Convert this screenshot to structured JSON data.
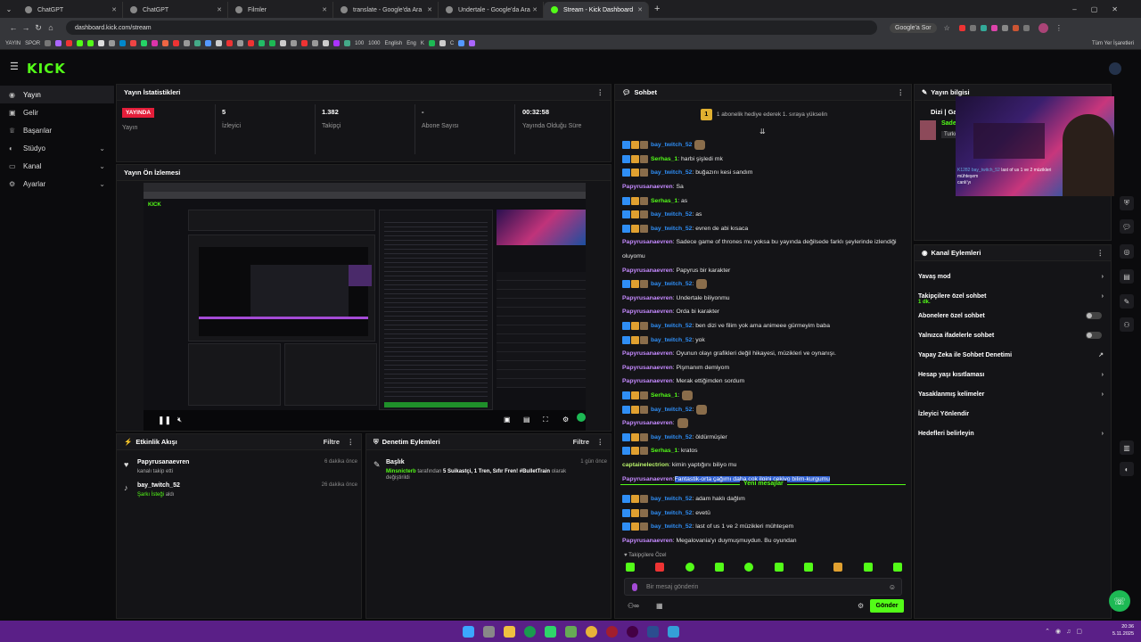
{
  "browser": {
    "tabs": [
      {
        "label": "ChatGPT",
        "active": false
      },
      {
        "label": "ChatGPT",
        "active": false
      },
      {
        "label": "Filmler",
        "active": false
      },
      {
        "label": "translate - Google'da Ara",
        "active": false
      },
      {
        "label": "Undertale - Google'da Ara",
        "active": false
      },
      {
        "label": "Stream - Kick Dashboard",
        "active": true
      }
    ],
    "url": "dashboard.kick.com/stream",
    "search_engine": "Google'a Sor",
    "bookmarks": [
      "YAYIN",
      "SPOR",
      "100",
      "1000",
      "English",
      "Eng",
      "K",
      "C"
    ],
    "all_bookmarks": "Tüm Yer İşaretleri"
  },
  "brand": {
    "logo": "KICK",
    "accent": "#53fc18"
  },
  "sidebar": {
    "items": [
      {
        "label": "Yayın",
        "icon": "broadcast-icon",
        "chev": false
      },
      {
        "label": "Gelir",
        "icon": "wallet-icon",
        "chev": false
      },
      {
        "label": "Başarılar",
        "icon": "trophy-icon",
        "chev": false
      },
      {
        "label": "Stüdyo",
        "icon": "palette-icon",
        "chev": true
      },
      {
        "label": "Kanal",
        "icon": "channel-icon",
        "chev": true
      },
      {
        "label": "Ayarlar",
        "icon": "gear-icon",
        "chev": true
      }
    ]
  },
  "stats": {
    "title": "Yayın İstatistikleri",
    "live_badge": "YAYINDA",
    "items": [
      {
        "value": "",
        "label": "Yayın"
      },
      {
        "value": "5",
        "label": "İzleyici"
      },
      {
        "value": "1.382",
        "label": "Takipçi"
      },
      {
        "value": "-",
        "label": "Abone Sayısı"
      },
      {
        "value": "00:32:58",
        "label": "Yayında Olduğu Süre"
      }
    ]
  },
  "preview": {
    "title": "Yayın Ön İzlemesi"
  },
  "activity": {
    "title": "Etkinlik Akışı",
    "filter": "Filtre",
    "items": [
      {
        "user": "Papyrusanaevren",
        "action": "kanalı takip etti",
        "time": "6 dakika önce"
      },
      {
        "user": "bay_twitch_52",
        "action": "Şarkı İsteği",
        "action2": "aldı",
        "time": "26 dakika önce"
      }
    ]
  },
  "moderation": {
    "title": "Denetim Eylemleri",
    "filter": "Filtre",
    "items": [
      {
        "title": "Başlık",
        "user": "Minsnicterb",
        "text": "tarafından",
        "stream_title": "5 Suikastçi, 1 Tren, Sıfır Fren! #BulletTrain",
        "suffix": "olarak",
        "line2": "değiştirildi",
        "time": "1 gün önce"
      }
    ]
  },
  "chat": {
    "title": "Sohbet",
    "pinned": "1 abonelik hediye ederek 1. sıraya yükselin",
    "new_messages": "Yeni mesajlar",
    "followers_only": "Takipçilere Özel",
    "input_placeholder": "Bir mesaj gönderin",
    "send": "Gönder",
    "messages": [
      {
        "user": "bay_twitch_52",
        "color": "#2f8ef5",
        "badges": 3,
        "text": "",
        "emote": true
      },
      {
        "user": "Serhas_1",
        "color": "#53fc18",
        "badges": 3,
        "text": ": harbi şişledi mk"
      },
      {
        "user": "bay_twitch_52",
        "color": "#2f8ef5",
        "badges": 3,
        "text": ": buğazını kesi sandım"
      },
      {
        "user": "Papyrusanaevren",
        "color": "#c58aff",
        "badges": 0,
        "text": ": Sa"
      },
      {
        "user": "Serhas_1",
        "color": "#53fc18",
        "badges": 3,
        "text": ": as"
      },
      {
        "user": "bay_twitch_52",
        "color": "#2f8ef5",
        "badges": 3,
        "text": ": as"
      },
      {
        "user": "bay_twitch_52",
        "color": "#2f8ef5",
        "badges": 3,
        "text": ": evren de abi kısaca"
      },
      {
        "user": "Papyrusanaevren",
        "color": "#c58aff",
        "badges": 0,
        "text": ": Sadece game of thrones mu yoksa bu yayında değilsede farklı şeylerinde izlendiği"
      },
      {
        "user": "",
        "color": "#e6e6e6",
        "badges": 0,
        "text": "oluyomu"
      },
      {
        "user": "Papyrusanaevren",
        "color": "#c58aff",
        "badges": 0,
        "text": ": Papyrus bir karakter"
      },
      {
        "user": "bay_twitch_52",
        "color": "#2f8ef5",
        "badges": 3,
        "text": ":",
        "emote": true
      },
      {
        "user": "Papyrusanaevren",
        "color": "#c58aff",
        "badges": 0,
        "text": ": Undertale biliyonmu"
      },
      {
        "user": "Papyrusanaevren",
        "color": "#c58aff",
        "badges": 0,
        "text": ": Orda bi karakter"
      },
      {
        "user": "bay_twitch_52",
        "color": "#2f8ef5",
        "badges": 3,
        "text": ": ben dizi ve filim yok ama animeee gürmeyim baba"
      },
      {
        "user": "bay_twitch_52",
        "color": "#2f8ef5",
        "badges": 3,
        "text": ": yok"
      },
      {
        "user": "Papyrusanaevren",
        "color": "#c58aff",
        "badges": 0,
        "text": ": Oyunun olayı grafikleri değil hikayesi, müzikleri ve oynanışı."
      },
      {
        "user": "Papyrusanaevren",
        "color": "#c58aff",
        "badges": 0,
        "text": ": Pişmanım demiyom"
      },
      {
        "user": "Papyrusanaevren",
        "color": "#c58aff",
        "badges": 0,
        "text": ": Merak ettiğimden sordum"
      },
      {
        "user": "Serhas_1",
        "color": "#53fc18",
        "badges": 3,
        "text": ":",
        "emote": true
      },
      {
        "user": "bay_twitch_52",
        "color": "#2f8ef5",
        "badges": 3,
        "text": ":",
        "emote": true
      },
      {
        "user": "Papyrusanaevren",
        "color": "#c58aff",
        "badges": 0,
        "text": ":",
        "emote": true
      },
      {
        "user": "bay_twitch_52",
        "color": "#2f8ef5",
        "badges": 3,
        "text": ": öldürmüşler"
      },
      {
        "user": "Serhas_1",
        "color": "#53fc18",
        "badges": 3,
        "text": ": kratos"
      },
      {
        "user": "captainelectrion",
        "color": "#b7f06a",
        "badges": 0,
        "text": ": kimin yaptığını biliyo mu"
      },
      {
        "user": "Papyrusanaevren",
        "color": "#c58aff",
        "badges": 0,
        "text": ": ",
        "highlight": "Fantastik-orta çağımı daha çok ilgini çekiyo bilim-kurgumu"
      }
    ],
    "messages_after": [
      {
        "user": "bay_twitch_52",
        "color": "#2f8ef5",
        "badges": 3,
        "text": ": adam haklı dağlım"
      },
      {
        "user": "bay_twitch_52",
        "color": "#2f8ef5",
        "badges": 3,
        "text": ": evetü"
      },
      {
        "user": "bay_twitch_52",
        "color": "#2f8ef5",
        "badges": 3,
        "text": ": last of us 1 ve 2 müzikleri mühteşem"
      },
      {
        "user": "Papyrusanaevren",
        "color": "#c58aff",
        "badges": 0,
        "text": ": Megalovania'yı duymuşmuydun. Bu oyundan"
      }
    ]
  },
  "stream_info": {
    "title": "Yayın bilgisi",
    "category": "Dizi | Ga",
    "tag": "Turkç",
    "user": "Sade",
    "cam_chat_user": "K1282 bay_twitch_52",
    "cam_chat_text": "last of us 1 ve 2 müzikleri mühteşem",
    "cam_chat_user2": "canlı'yı"
  },
  "channel_actions": {
    "title": "Kanal Eylemleri",
    "items": [
      {
        "label": "Yavaş mod",
        "control": "chevron"
      },
      {
        "label": "Takipçilere özel sohbet",
        "sub": "1 dk.",
        "control": "chevron"
      },
      {
        "label": "Abonelere özel sohbet",
        "control": "toggle"
      },
      {
        "label": "Yalnızca ifadelerle sohbet",
        "control": "toggle"
      },
      {
        "label": "Yapay Zeka ile Sohbet Denetimi",
        "control": "ext"
      },
      {
        "label": "Hesap yaşı kısıtlaması",
        "control": "chevron"
      },
      {
        "label": "Yasaklanmış kelimeler",
        "control": "chevron"
      },
      {
        "label": "İzleyici Yönlendir",
        "control": "none"
      },
      {
        "label": "Hedefleri belirleyin",
        "control": "chevron"
      }
    ]
  },
  "taskbar": {
    "time": "20:36",
    "date": "5.11.2025"
  }
}
